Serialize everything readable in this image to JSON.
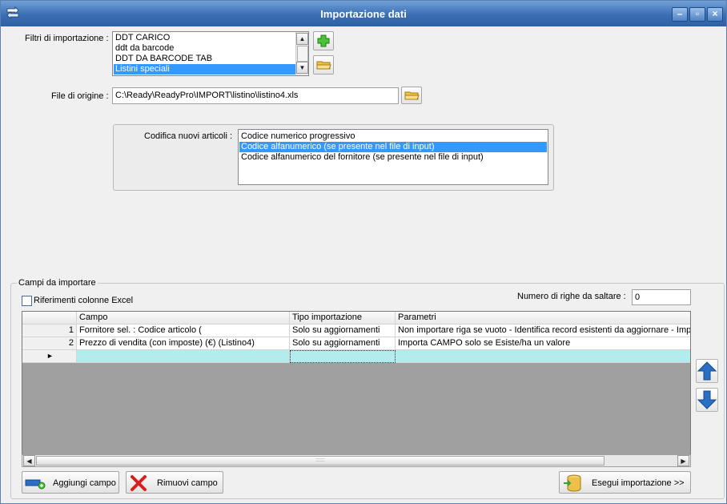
{
  "window": {
    "title": "Importazione dati"
  },
  "filters": {
    "label": "Filtri di importazione :",
    "items": [
      "DDT CARICO",
      "ddt da barcode",
      "DDT DA BARCODE TAB",
      "Listini speciali"
    ],
    "selected_index": 3
  },
  "source_file": {
    "label": "File di origine :",
    "value": "C:\\Ready\\ReadyPro\\IMPORT\\listino\\listino4.xls"
  },
  "encoding": {
    "label": "Codifica nuovi articoli :",
    "options": [
      "Codice numerico progressivo",
      "Codice alfanumerico (se presente nel file di input)",
      "Codice alfanumerico del fornitore (se presente nel file di input)"
    ],
    "selected_index": 1
  },
  "fields_group": {
    "title": "Campi da importare",
    "excel_refs_label": "Riferimenti colonne Excel",
    "excel_refs_checked": false,
    "skip_rows_label": "Numero di righe da saltare :",
    "skip_rows_value": "0"
  },
  "grid": {
    "columns": [
      "Campo",
      "Tipo importazione",
      "Parametri"
    ],
    "rows": [
      {
        "n": "1",
        "campo": "Fornitore sel. : Codice articolo (",
        "tipo": "Solo su aggiornamenti",
        "parametri": "Non importare riga se vuoto - Identifica record esistenti da aggiornare - Impo"
      },
      {
        "n": "2",
        "campo": "Prezzo di vendita (con imposte) (€) (Listino4)",
        "tipo": "Solo su aggiornamenti",
        "parametri": "Importa CAMPO solo se Esiste/ha un valore"
      }
    ],
    "new_row_marker": "►"
  },
  "buttons": {
    "add_field": "Aggiungi campo",
    "remove_field": "Rimuovi campo",
    "run_import": "Esegui importazione >>"
  },
  "colors": {
    "title_bar": "#3b6fb3",
    "selection": "#3399ff",
    "new_row": "#b3ecec",
    "grid_bg": "#a0a0a0",
    "arrow_blue": "#2a6fc4"
  }
}
